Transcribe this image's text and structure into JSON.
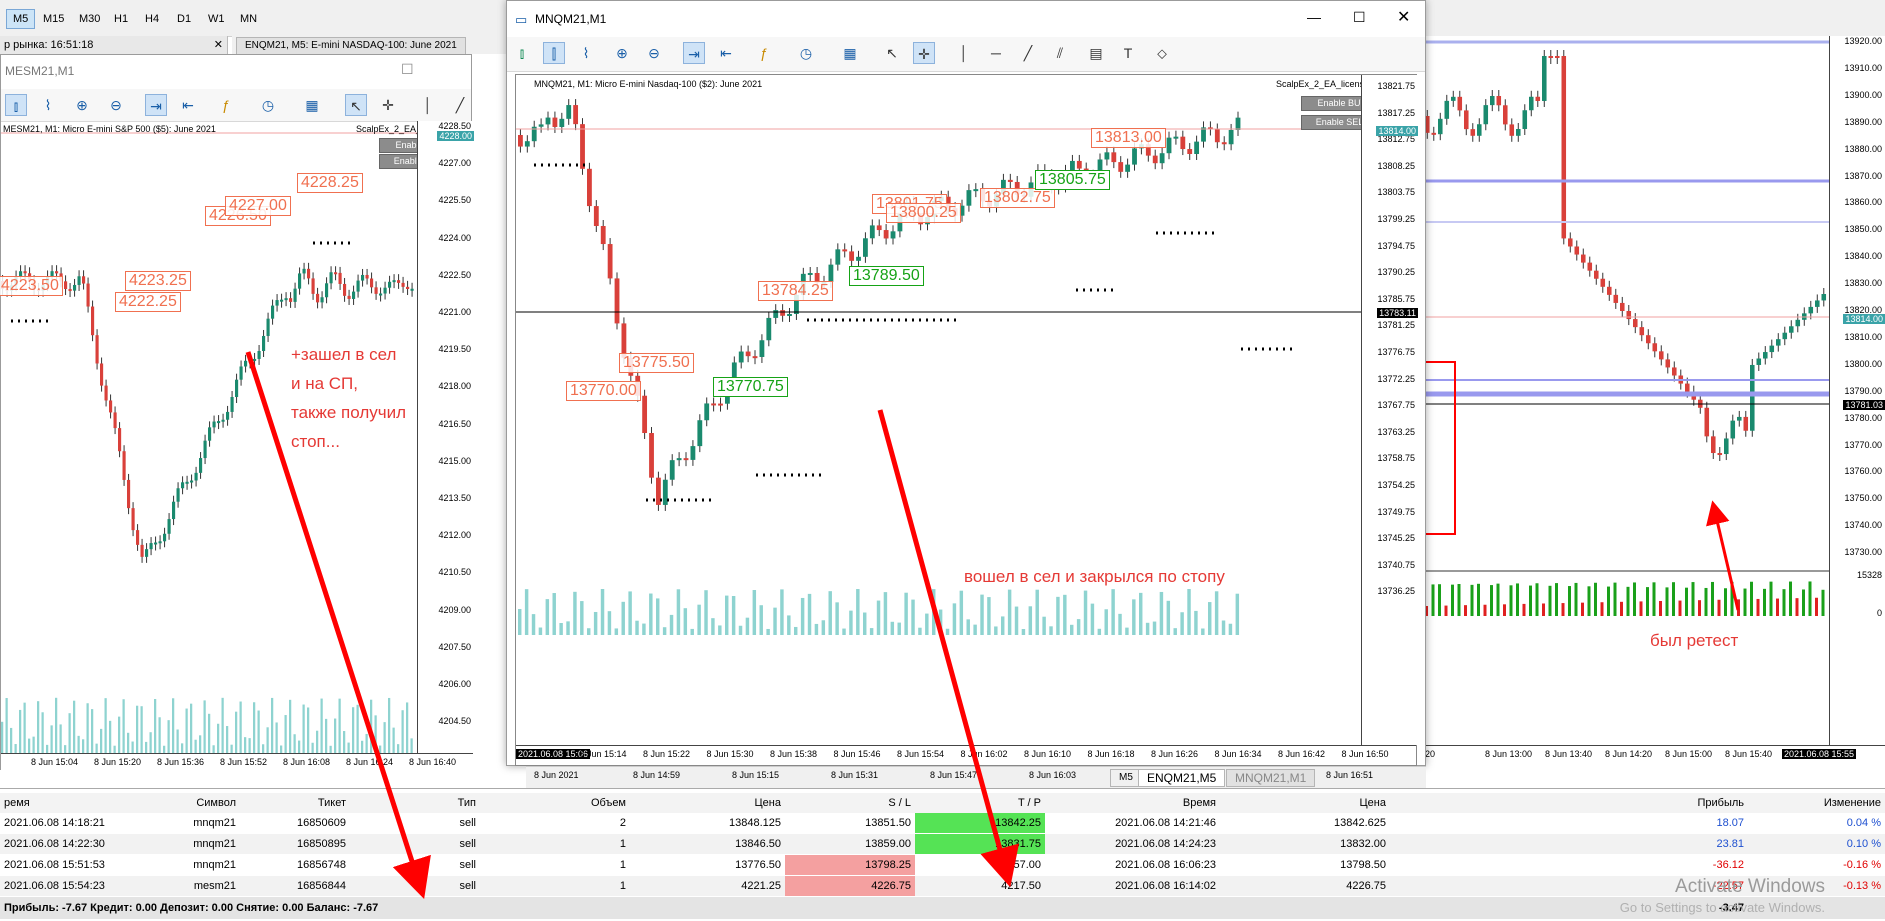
{
  "timeframes": [
    "M5",
    "M15",
    "M30",
    "H1",
    "H4",
    "D1",
    "W1",
    "MN"
  ],
  "active_timeframe": "M5",
  "market_watch": "р рынка: 16:51:18",
  "tabs": {
    "top": [
      "ENQM21, M5:  E-mini NASDAQ-100: June 2021"
    ],
    "bottom": [
      "M5",
      "ENQM21,M5",
      "MNQM21,M1"
    ]
  },
  "left_window": {
    "title": "MESM21,M1",
    "info": "MESM21, M1:  Micro E-mini S&P 500 ($5): June 2021",
    "ea_name": "ScalpEx_2_EA_license",
    "buy_btn": "Enable BUY",
    "sell_btn": "Enable SELL",
    "prices": [
      "4228.50",
      "4227.00",
      "4225.50",
      "4224.00",
      "4222.50",
      "4221.00",
      "4219.50",
      "4218.00",
      "4216.50",
      "4215.00",
      "4213.50",
      "4212.00",
      "4210.50",
      "4209.00",
      "4207.50",
      "4206.00",
      "4204.50"
    ],
    "current_price": "4228.00",
    "times": [
      "8 Jun 15:04",
      "8 Jun 15:20",
      "8 Jun 15:36",
      "8 Jun 15:52",
      "8 Jun 16:08",
      "8 Jun 16:24",
      "8 Jun 16:40"
    ],
    "trade_labels": [
      "4223.25",
      "4222.25",
      "4226.50",
      "4227.00",
      "4228.25",
      "4223.50"
    ],
    "annotation": [
      "+зашел в сел",
      "и на СП,",
      "также получил",
      "стоп..."
    ]
  },
  "center_window": {
    "title": "MNQM21,M1",
    "info": "MNQM21, M1:  Micro E-mini Nasdaq-100 ($2): June 2021",
    "ea_name": "ScalpEx_2_EA_license",
    "buy_btn": "Enable BUY",
    "sell_btn": "Enable SELL",
    "prices": [
      "13821.75",
      "13817.25",
      "13812.75",
      "13808.25",
      "13803.75",
      "13799.25",
      "13794.75",
      "13790.25",
      "13785.75",
      "13781.25",
      "13776.75",
      "13772.25",
      "13767.75",
      "13763.25",
      "13758.75",
      "13754.25",
      "13749.75",
      "13745.25",
      "13740.75",
      "13736.25"
    ],
    "current_price": "13814.00",
    "line_price": "13783.11",
    "times": [
      "2021.06.08 15:06",
      "8 Jun 15:14",
      "8 Jun 15:22",
      "8 Jun 15:30",
      "8 Jun 15:38",
      "8 Jun 15:46",
      "8 Jun 15:54",
      "8 Jun 16:02",
      "8 Jun 16:10",
      "8 Jun 16:18",
      "8 Jun 16:26",
      "8 Jun 16:34",
      "8 Jun 16:42",
      "8 Jun 16:50"
    ],
    "under_times": [
      "8 Jun 2021",
      "8 Jun 14:59",
      "8 Jun 15:15",
      "8 Jun 15:31",
      "8 Jun 15:47",
      "8 Jun 16:03",
      "8 Jun 16:19",
      "8 Jun 16:35",
      "8 Jun 16:51"
    ],
    "trade_labels_red": [
      "13770.00",
      "13775.50",
      "13784.25",
      "13801.75",
      "13800.25",
      "13802.75",
      "13813.00"
    ],
    "trade_labels_green": [
      "13770.75",
      "13789.50",
      "13805.75"
    ],
    "annotation": "вошел в сел и закрылся по стопу"
  },
  "right_window": {
    "prices": [
      "13920.00",
      "13910.00",
      "13900.00",
      "13890.00",
      "13880.00",
      "13870.00",
      "13860.00",
      "13850.00",
      "13840.00",
      "13830.00",
      "13820.00",
      "13810.00",
      "13800.00",
      "13790.00",
      "13780.00",
      "13770.00",
      "13760.00",
      "13750.00",
      "13740.00",
      "13730.00"
    ],
    "current_price": "13814.00",
    "line_price": "13781.03",
    "volume_label": "15328",
    "volume_zero": "0",
    "times": [
      "20",
      "8 Jun 13:00",
      "8 Jun 13:40",
      "8 Jun 14:20",
      "8 Jun 15:00",
      "8 Jun 15:40",
      "2021.06.08 15:55"
    ],
    "annotation": "был ретест"
  },
  "terminal": {
    "headers": [
      "ремя",
      "Символ",
      "Тикет",
      "Тип",
      "Объем",
      "Цена",
      "S / L",
      "T / P",
      "Время",
      "Цена",
      "Прибыль",
      "Изменение"
    ],
    "rows": [
      [
        "2021.06.08 14:18:21",
        "mnqm21",
        "16850609",
        "sell",
        "2",
        "13848.125",
        "13851.50",
        "13842.25",
        "2021.06.08 14:21:46",
        "13842.625",
        "18.07",
        "0.04 %"
      ],
      [
        "2021.06.08 14:22:30",
        "mnqm21",
        "16850895",
        "sell",
        "1",
        "13846.50",
        "13859.00",
        "13831.75",
        "2021.06.08 14:24:23",
        "13832.00",
        "23.81",
        "0.10 %"
      ],
      [
        "2021.06.08 15:51:53",
        "mnqm21",
        "16856748",
        "sell",
        "1",
        "13776.50",
        "13798.25",
        "13757.00",
        "2021.06.08 16:06:23",
        "13798.50",
        "-36.12",
        "-0.16 %"
      ],
      [
        "2021.06.08 15:54:23",
        "mesm21",
        "16856844",
        "sell",
        "1",
        "4221.25",
        "4226.75",
        "4217.50",
        "2021.06.08 16:14:02",
        "4226.75",
        "-22.57",
        "-0.13 %"
      ]
    ],
    "summary": "Прибыль: -7.67  Кредит: 0.00  Депозит: 0.00  Снятие: 0.00  Баланс: -7.67",
    "total": "-3.47",
    "activate_title": "Activate Windows",
    "activate_sub": "Go to Settings to activate Windows."
  },
  "colors": {
    "bull": "#1a8a6e",
    "bear": "#d9403a",
    "arrow": "#ff0000",
    "tp_green": "#55e355",
    "sl_red": "#f4a0a0",
    "level": "#9999ee"
  }
}
